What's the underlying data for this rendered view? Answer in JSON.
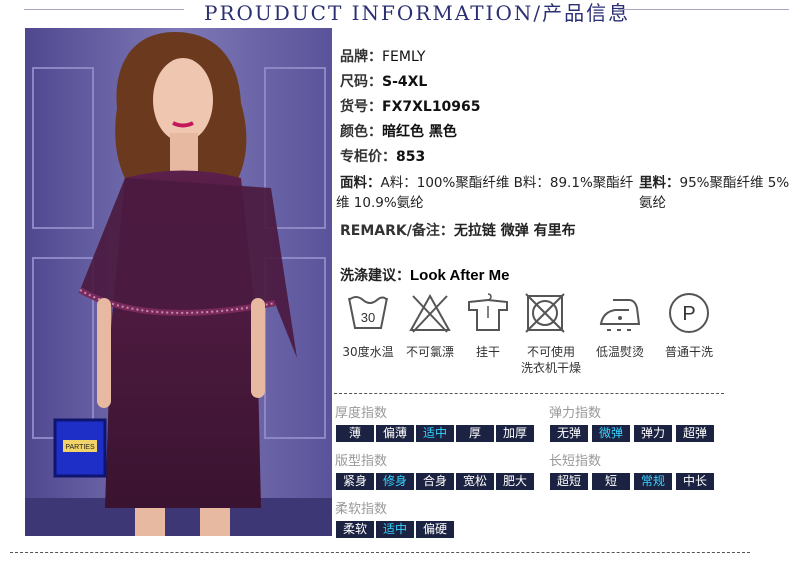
{
  "header": {
    "title": "PROUDUCT INFORMATION/产品信息"
  },
  "product": {
    "brand_label": "品牌：",
    "brand": "FEMLY",
    "size_label": "尺码：",
    "size": "S-4XL",
    "code_label": "货号：",
    "code": "FX7XL10965",
    "color_label": "颜色：",
    "color": "暗红色 黑色",
    "price_label": "专柜价：",
    "price": "853",
    "fabric_label": "面料：",
    "fabric_line1": "A料：100%聚酯纤维 B料：89.1%聚酯纤",
    "fabric_line2": "维 10.9%氨纶",
    "lining_label": "里料：",
    "lining_line1": "95%聚酯纤维 5%",
    "lining_line2": "氨纶",
    "remark_label": "REMARK/备注：",
    "remark": "无拉链 微弹 有里布"
  },
  "care": {
    "title_label": "洗涤建议：",
    "title_value": "Look After Me",
    "wash_temp": "30",
    "items": [
      {
        "icon": "wash-30-icon",
        "label": "30度水温"
      },
      {
        "icon": "no-bleach-icon",
        "label": "不可氯漂"
      },
      {
        "icon": "hang-dry-icon",
        "label": "挂干"
      },
      {
        "icon": "no-tumble-dry-icon",
        "label": "不可使用",
        "label2": "洗衣机干燥"
      },
      {
        "icon": "low-iron-icon",
        "label": "低温熨烫"
      },
      {
        "icon": "dry-clean-p-icon",
        "label": "普通干洗"
      }
    ]
  },
  "attributes": {
    "thickness": {
      "label": "厚度指数",
      "options": [
        "薄",
        "偏薄",
        "适中",
        "厚",
        "加厚"
      ],
      "selected": "适中"
    },
    "fit": {
      "label": "版型指数",
      "options": [
        "紧身",
        "修身",
        "合身",
        "宽松",
        "肥大"
      ],
      "selected": "修身"
    },
    "softness": {
      "label": "柔软指数",
      "options": [
        "柔软",
        "适中",
        "偏硬"
      ],
      "selected": "适中"
    },
    "elasticity": {
      "label": "弹力指数",
      "options": [
        "无弹",
        "微弹",
        "弹力",
        "超弹"
      ],
      "selected": "微弹"
    },
    "length": {
      "label": "长短指数",
      "options": [
        "超短",
        "短",
        "常规",
        "中长"
      ],
      "selected": "常规"
    }
  },
  "colors": {
    "title": "#2b2f73",
    "chip_bg": "#1c2342",
    "chip_active_text": "#36d2ff",
    "dress": "#4a1a3c"
  },
  "photo": {
    "clutch_text": "PARTIES"
  }
}
